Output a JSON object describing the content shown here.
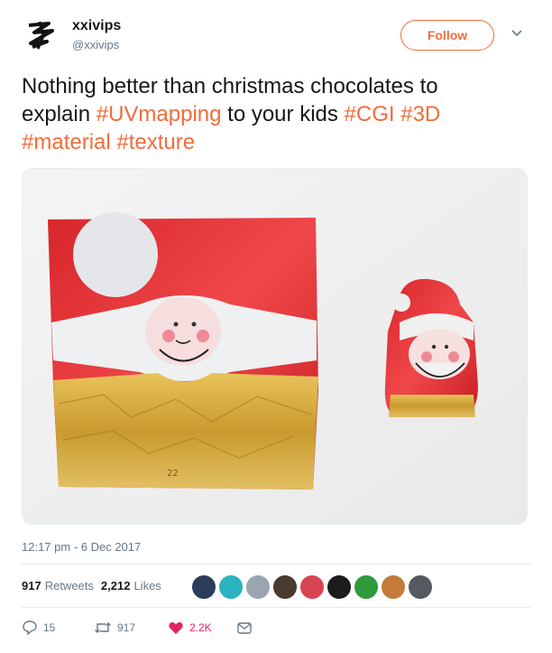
{
  "user": {
    "display_name": "xxivips",
    "handle": "@xxivips",
    "avatar_icon": "avatar-logo-icon"
  },
  "header": {
    "follow_label": "Follow",
    "more_icon": "chevron-down-icon"
  },
  "tweet": {
    "line1": "Nothing better than christmas chocolates to",
    "line2_prefix": "explain ",
    "hashtag_uvmapping": "#UVmapping",
    "line2_mid": " to your kids ",
    "hashtag_cgi": "#CGI",
    "hashtag_3d": "#3D",
    "hashtag_material": "#material",
    "hashtag_texture": "#texture",
    "hashtag_color": "#f26c3a"
  },
  "media": {
    "foil_label": "22"
  },
  "meta": {
    "timestamp": "12:17 pm - 6 Dec 2017"
  },
  "stats": {
    "retweets_count": "917",
    "retweets_label": "Retweets",
    "likes_count": "2,212",
    "likes_label": "Likes"
  },
  "actions": {
    "reply_count": "15",
    "retweet_count": "917",
    "like_count": "2.2K",
    "like_color": "#e0245e"
  }
}
